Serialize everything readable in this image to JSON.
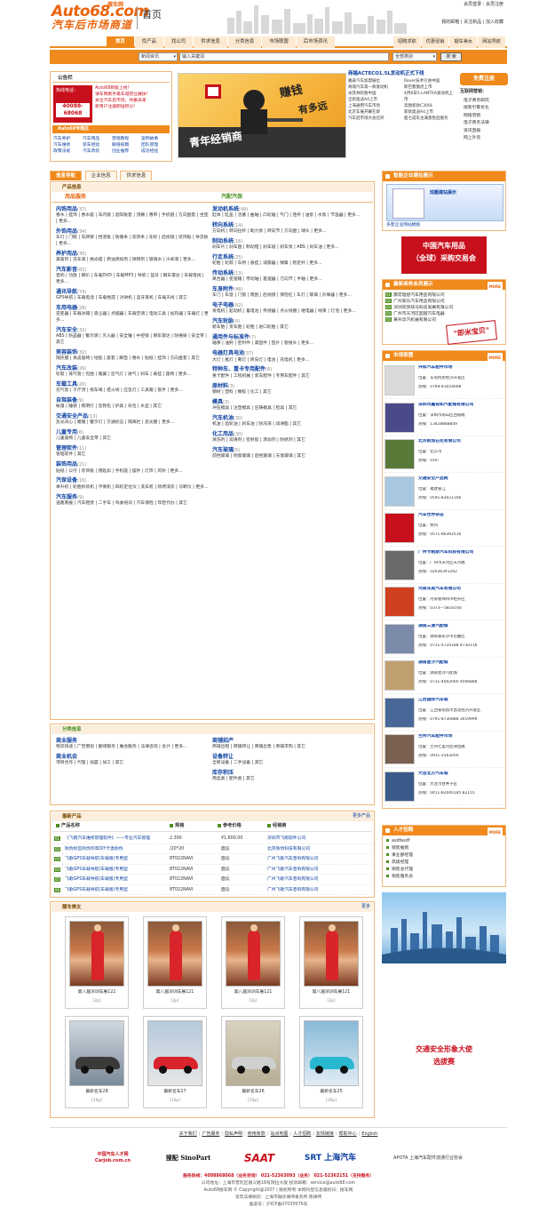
{
  "site": {
    "logo_main": "Auto68.com",
    "logo_sub": "汽车后市场商道",
    "logo_tag": "搜车网",
    "page_label": "首页"
  },
  "toplinks": [
    "会员登录",
    "会员注册",
    "我的邮箱",
    "关注新品",
    "加入收藏"
  ],
  "nav": [
    "首页",
    "找产品",
    "找公司",
    "供求信息",
    "分类信息",
    "市场联盟",
    "后市场资讯"
  ],
  "nav_right": [
    "招聘求职",
    "优惠促销",
    "靓车美女",
    "网站导航"
  ],
  "search": {
    "type": "新闻资讯",
    "placeholder": "输入关键词",
    "cat": "全部类别",
    "btn": "搜 索"
  },
  "announce": {
    "title": "公告栏",
    "hotline_label": "热线电话：",
    "hotline": "40088-68068",
    "lines": [
      "Auto68新版上线!",
      "请车网携手美车城营业展扶!",
      "关注汽车后市场，共赢未来",
      "新用户注册即送积分!"
    ],
    "sub_title": "Auto68专题区",
    "sub_links": [
      "汽车养护",
      "汽车用品",
      "营销教程",
      "案例故事",
      "汽车维修",
      "装车经验",
      "联络投稿",
      "团队管理",
      "政策法规",
      "汽车改装",
      "创业推荐",
      "成功经验"
    ]
  },
  "banner": {
    "big": "赚钱",
    "mid": "有多远",
    "bottom": "青年经销商"
  },
  "news": {
    "head": "商福ACTECO1.5L发动机正式下线",
    "items": [
      "雅泰汽车加盟展位",
      "奇瑞汽车第一款发动机",
      "米其林轮胎中国",
      "全新奥迪A4上市",
      "上海通用汽车市场",
      "北京车展开幕在即",
      "汽车后市场大会召开",
      "Rover技术引进中国",
      "斯巴鲁傲虎上市",
      "4月8日5-LANTRA发动机上市",
      "奔驰新款C300L",
      "新款奥迪A4上市",
      "超七成车主满意售后服务"
    ]
  },
  "pricing": {
    "title": "互联网营销：",
    "items": [
      "电子商务研究",
      "搜索引擎优化",
      "网络营销",
      "电子商务法律",
      "资讯直报",
      "网上外贸"
    ]
  },
  "tabs": [
    "信息导航",
    "企业信息",
    "供求信息"
  ],
  "left_title": "产品信息",
  "col1_title": "用品服务",
  "col2_title": "汽配汽保",
  "col1": [
    {
      "h": "内饰用品",
      "n": "(37)",
      "t": "香水 | 挂饰 | 香水座 | 车内镜 | 遮阳板套 | 顶棚 | 香带 | 手机链 | 方向盘套 | 坐垫 | 更多..."
    },
    {
      "h": "外饰用品",
      "n": "(34)",
      "t": "车灯 | 门碗 | 车牌架 | 挡泥板 | 防撞条 | 装饰条 | 车标 | 后视镜 | 装饰贴 | 导流板 | 更多..."
    },
    {
      "h": "养护用品",
      "n": "(30)",
      "t": "美容剂 | 洗车液 | 抛光蜡 | 燃油添加剂 | 除锈剂 | 玻璃水 | 冷却液 | 更多..."
    },
    {
      "h": "汽车影音",
      "n": "(65)",
      "t": "音响 | 功放 | 喇叭 | 车载DVD | 车载MP3 | 导航 | 蓝牙 | 倒车雷达 | 车载电视 | 更多..."
    },
    {
      "h": "通讯导航",
      "n": "(74)",
      "t": "GPS导航 | 车载电话 | 车载免提 | 对讲机 | 蓝牙耳机 | 车载天线 | 其它"
    },
    {
      "h": "车用电器",
      "n": "(28)",
      "t": "逆变器 | 车载冰箱 | 吸尘器 | 点烟器 | 车载空调 | 电动工具 | 加热器 | 车载灯 | 更多..."
    },
    {
      "h": "汽车安全",
      "n": "(32)",
      "t": "ABS | 防盗器 | 警示牌 | 灭火器 | 安全锤 | 中控锁 | 倒车雷达 | 防撞梁 | 安全带 | 其它"
    },
    {
      "h": "美容装饰",
      "n": "(32)",
      "t": "隔热膜 | 真皮座椅 | 地胶 | 座套 | 脚垫 | 香水 | 贴纸 | 挂饰 | 方向盘套 | 其它"
    },
    {
      "h": "汽车改装",
      "n": "(26)",
      "t": "轮毂 | 排气管 | 包围 | 尾翼 | 氙气灯 | 进气 | 刹车 | 悬挂 | 座椅 | 更多..."
    },
    {
      "h": "车载工具",
      "n": "(20)",
      "t": "充气泵 | 千斤顶 | 拖车绳 | 搭火线 | 应急灯 | 工具箱 | 扳手 | 更多..."
    },
    {
      "h": "自驾装备",
      "n": "(9)",
      "t": "帐篷 | 睡袋 | 照明灯 | 急救包 | 炉具 | 背包 | 水壶 | 其它"
    },
    {
      "h": "交通安全产品",
      "n": "(13)",
      "t": "反光背心 | 路锥 | 警示灯 | 交通标志 | 隔离栏 | 反光膜 | 更多..."
    },
    {
      "h": "儿童专用",
      "n": "(6)",
      "t": "儿童座椅 | 儿童安全带 | 其它"
    },
    {
      "h": "管理软件",
      "n": "(11)",
      "t": "管理软件 | 其它"
    },
    {
      "h": "装饰用品",
      "n": "(21)",
      "t": "贴纸 | 公仔 | 装饰板 | 钥匙扣 | 手机座 | 摆件 | 灯饰 | 风铃 | 更多..."
    },
    {
      "h": "汽保设备",
      "n": "(16)",
      "t": "举升机 | 轮胎拆装机 | 平衡机 | 四轮定位仪 | 洗车机 | 喷烤漆房 | 诊断仪 | 更多..."
    },
    {
      "h": "汽车服务",
      "n": "(9)",
      "t": "道路救援 | 汽车租赁 | 二手车 | 驾驶培训 | 汽车保险 | 年检代办 | 其它"
    }
  ],
  "col2": [
    {
      "h": "发动机系统",
      "n": "(49)",
      "t": "缸体 | 缸盖 | 活塞 | 曲轴 | 凸轮轴 | 气门 | 连杆 | 油泵 | 水泵 | 节温器 | 更多..."
    },
    {
      "h": "转向系统",
      "n": "(14)",
      "t": "方向机 | 转向拉杆 | 助力泵 | 转向节 | 方向盘 | 球头 | 更多..."
    },
    {
      "h": "制动系统",
      "n": "(16)",
      "t": "刹车片 | 刹车盘 | 制动钳 | 刹车鼓 | 刹车泵 | ABS | 刹车油 | 更多..."
    },
    {
      "h": "行走系统",
      "n": "(25)",
      "t": "轮胎 | 轮毂 | 车桥 | 悬挂 | 减震器 | 弹簧 | 稳定杆 | 更多..."
    },
    {
      "h": "传动系统",
      "n": "(13)",
      "t": "离合器 | 变速箱 | 传动轴 | 差速器 | 万向节 | 半轴 | 更多..."
    },
    {
      "h": "车身附件",
      "n": "(48)",
      "t": "车门 | 车窗 | 门锁 | 雨刮 | 后视镜 | 保险杠 | 车灯 | 玻璃 | 升降器 | 更多..."
    },
    {
      "h": "电子电器",
      "n": "(62)",
      "t": "发电机 | 起动机 | 蓄电池 | 传感器 | 点火线圈 | 继电器 | 线束 | 灯泡 | 更多..."
    },
    {
      "h": "汽车轮胎",
      "n": "(4)",
      "t": "轿车胎 | 货车胎 | 轮胎 | 进口轮胎 | 其它"
    },
    {
      "h": "通用件与标准件",
      "n": "(7)",
      "t": "轴承 | 油封 | 密封件 | 紧固件 | 垫片 | 管接头 | 更多..."
    },
    {
      "h": "电器灯具电池",
      "n": "(37)",
      "t": "大灯 | 尾灯 | 雾灯 | 转向灯 | 电池 | 充电机 | 更多..."
    },
    {
      "h": "特种车、重卡专用配件",
      "n": "(6)",
      "t": "重卡配件 | 工程机械 | 客车配件 | 专用车配件 | 其它"
    },
    {
      "h": "原材料",
      "n": "(3)",
      "t": "钢材 | 塑料 | 橡胶 | 化工 | 其它"
    },
    {
      "h": "模具",
      "n": "(3)",
      "t": "冲压模具 | 注塑模具 | 压铸模具 | 检具 | 其它"
    },
    {
      "h": "汽车机油",
      "n": "(30)",
      "t": "机油 | 齿轮油 | 刹车油 | 防冻液 | 润滑脂 | 其它"
    },
    {
      "h": "化工用品",
      "n": "(30)",
      "t": "清洗剂 | 润滑剂 | 密封胶 | 添加剂 | 防锈剂 | 其它"
    },
    {
      "h": "汽车玻璃",
      "n": "(5)",
      "t": "前挡玻璃 | 侧窗玻璃 | 后挡玻璃 | 天窗玻璃 | 其它"
    }
  ],
  "cls_title": "分类信息",
  "cls_left": [
    {
      "h": "商业服务",
      "t": "物流快递 | 广告策划 | 翻译服务 | 展会服务 | 法律咨询 | 会计 | 更多..."
    },
    {
      "h": "商业机会",
      "t": "项目合作 | 代理 | 加盟 | 加工 | 其它"
    }
  ],
  "cls_right": [
    {
      "h": "商铺招产",
      "t": "商铺出租 | 商铺转让 | 商铺出售 | 商铺求购 | 其它"
    },
    {
      "h": "设备转让",
      "t": "全新设备 | 二手设备 | 其它"
    },
    {
      "h": "库存积压",
      "t": "用品类 | 配件类 | 其它"
    }
  ],
  "newprod": {
    "title": "最新产品",
    "more": "更多产品",
    "cols": [
      "产品名称",
      "规格",
      "参考价格",
      "经销商"
    ],
    "rows": [
      [
        "《飞跑汽车维修管理软件》——专业汽车管理",
        "2.300",
        "¥1,600.00",
        "深圳市飞跑软件公司"
      ],
      [
        "防伪标签防伪印章DIY卡类防伪",
        "/20*20",
        "面议",
        "北京防伪科技有限公司"
      ],
      [
        "飞歌GPS车载导航(车载版)专用型",
        "8T022NAVI",
        "面议",
        "广州飞歌汽车音响有限公司"
      ],
      [
        "飞歌GPS车载导航(车载版)专用型",
        "8T022NAVI",
        "面议",
        "广州飞歌汽车音响有限公司"
      ],
      [
        "飞歌GPS车载导航(车载版)专用型",
        "8T022NAVI",
        "面议",
        "广州飞歌汽车音响有限公司"
      ],
      [
        "飞歌GPS车载导航(车载版)专用型",
        "8T022NAVI",
        "面议",
        "广州飞歌汽车音响有限公司"
      ]
    ]
  },
  "gallery": {
    "title": "靓车美女",
    "more": "更多",
    "items": [
      {
        "cap": "第八届深圳车展122",
        "sub": "[2p]"
      },
      {
        "cap": "第八届深圳车展121",
        "sub": "[2p]"
      },
      {
        "cap": "第八届深圳车展121",
        "sub": "[2p]"
      },
      {
        "cap": "第八届深圳车展121",
        "sub": "[2p]"
      },
      {
        "cap": "最新名车28",
        "sub": "[10p]"
      },
      {
        "cap": "最新名车27",
        "sub": "[10p]"
      },
      {
        "cap": "最新名车26",
        "sub": "[10p]"
      },
      {
        "cap": "最新名车25",
        "sub": "[10p]"
      }
    ]
  },
  "right": {
    "ad1_title": "智能企业建站展示",
    "ad1_text": "炫酷建站展示",
    "ad1_link": "多套企业网站模板",
    "ad2_line1": "中国汽车用品",
    "ad2_line2": "（全球）采购交易会",
    "members_title": "最新商务会员展示",
    "members": [
      "康昂理想汽车用品有限公司",
      "广州家乐汽车用品有限公司",
      "深圳欢快快马科技发展有限公司",
      "广州市天河区超越汽车电器",
      "某州华汽机械有限公司"
    ],
    "league_title": "市场联盟",
    "league": [
      {
        "name": "兴和汽车配件市场",
        "addr": "位置：东莞阿凯经济开发区",
        "tel": "热线：0769-81654668"
      },
      {
        "name": "深圳市鑫锐和汽配城有限公司",
        "addr": "位置：深圳市南山区西丽路",
        "tel": "热线：13428888849"
      },
      {
        "name": "北京新加石化有限公司",
        "addr": "位置：北京市",
        "tel": "热线：010-"
      },
      {
        "name": "交通安全产品网",
        "addr": "位置：福建省江",
        "tel": "热线：0591-83021166"
      },
      {
        "name": "汽车世界杂志",
        "addr": "位置：杭州",
        "tel": "热线：0571-86392516"
      },
      {
        "name": "广州卡帕斯汽车科技有限公司",
        "addr": "位置：广州市天河区天河路",
        "tel": "热线：02036391262"
      },
      {
        "name": "河南东昊汽车有限公司",
        "addr": "位置：河南省郑州市经开区",
        "tel": "热线：0373---5810160"
      },
      {
        "name": "湖南三湘汽配城",
        "addr": "位置：湖南省长沙市岳麓区",
        "tel": "热线：0731-4724188 4730116"
      },
      {
        "name": "湖南星沙汽配城",
        "addr": "位置：湖南星沙汽配城",
        "tel": "热线：0731-4002000 4006888"
      },
      {
        "name": "江西国际汽车城",
        "addr": "位置：江西省南昌市昌北经济开发区",
        "tel": "热线：0791-8730888 3019999"
      },
      {
        "name": "兰州汽车配件市场",
        "addr": "位置：兰州七里河西津西路",
        "tel": "热线：0931-2563056"
      },
      {
        "name": "大连北方汽车城",
        "addr": "位置：大连市甘井子区",
        "tel": "热线：0411-82040185 82155"
      }
    ],
    "jobs_title": "人才招聘",
    "jobs": [
      "asdfasdf",
      "销售推销",
      "事业部经理",
      "高级经理",
      "销售总代理",
      "销售服务员"
    ],
    "ad3": "交通安全形象大使选拔赛",
    "ad3_line1": "交通安全形象大使",
    "ad3_line2": "选拔赛"
  },
  "footer": {
    "links": [
      "关于我们",
      "广告服务",
      "隐私声明",
      "使用条款",
      "站点地图",
      "人才招聘",
      "友情链接",
      "帮助中心",
      "English"
    ],
    "logos": [
      "中国汽车人才网 Carjob.com.cn",
      "搜配 SinoPart",
      "SAAT",
      "SRT 上海汽车",
      "APOTA 上海汽车配件流通行业协会"
    ],
    "hot": "服务热线：4008868068（业务咨询）  021-52363093（业务）  021-52363151（支持服务）",
    "addr": "公司地址：上海市普陀区顺义路18号阿拉大厦  投诉邮箱：service@auto68.com",
    "copy": "Auto68搜车网 © Copyright@2007 | 版权所有  本网刊登信息版权归：搜车网",
    "law": "常年法律顾问：上海市融华律师事务所  陈律师",
    "icp": "备案号：沪ICP备07035676号"
  }
}
